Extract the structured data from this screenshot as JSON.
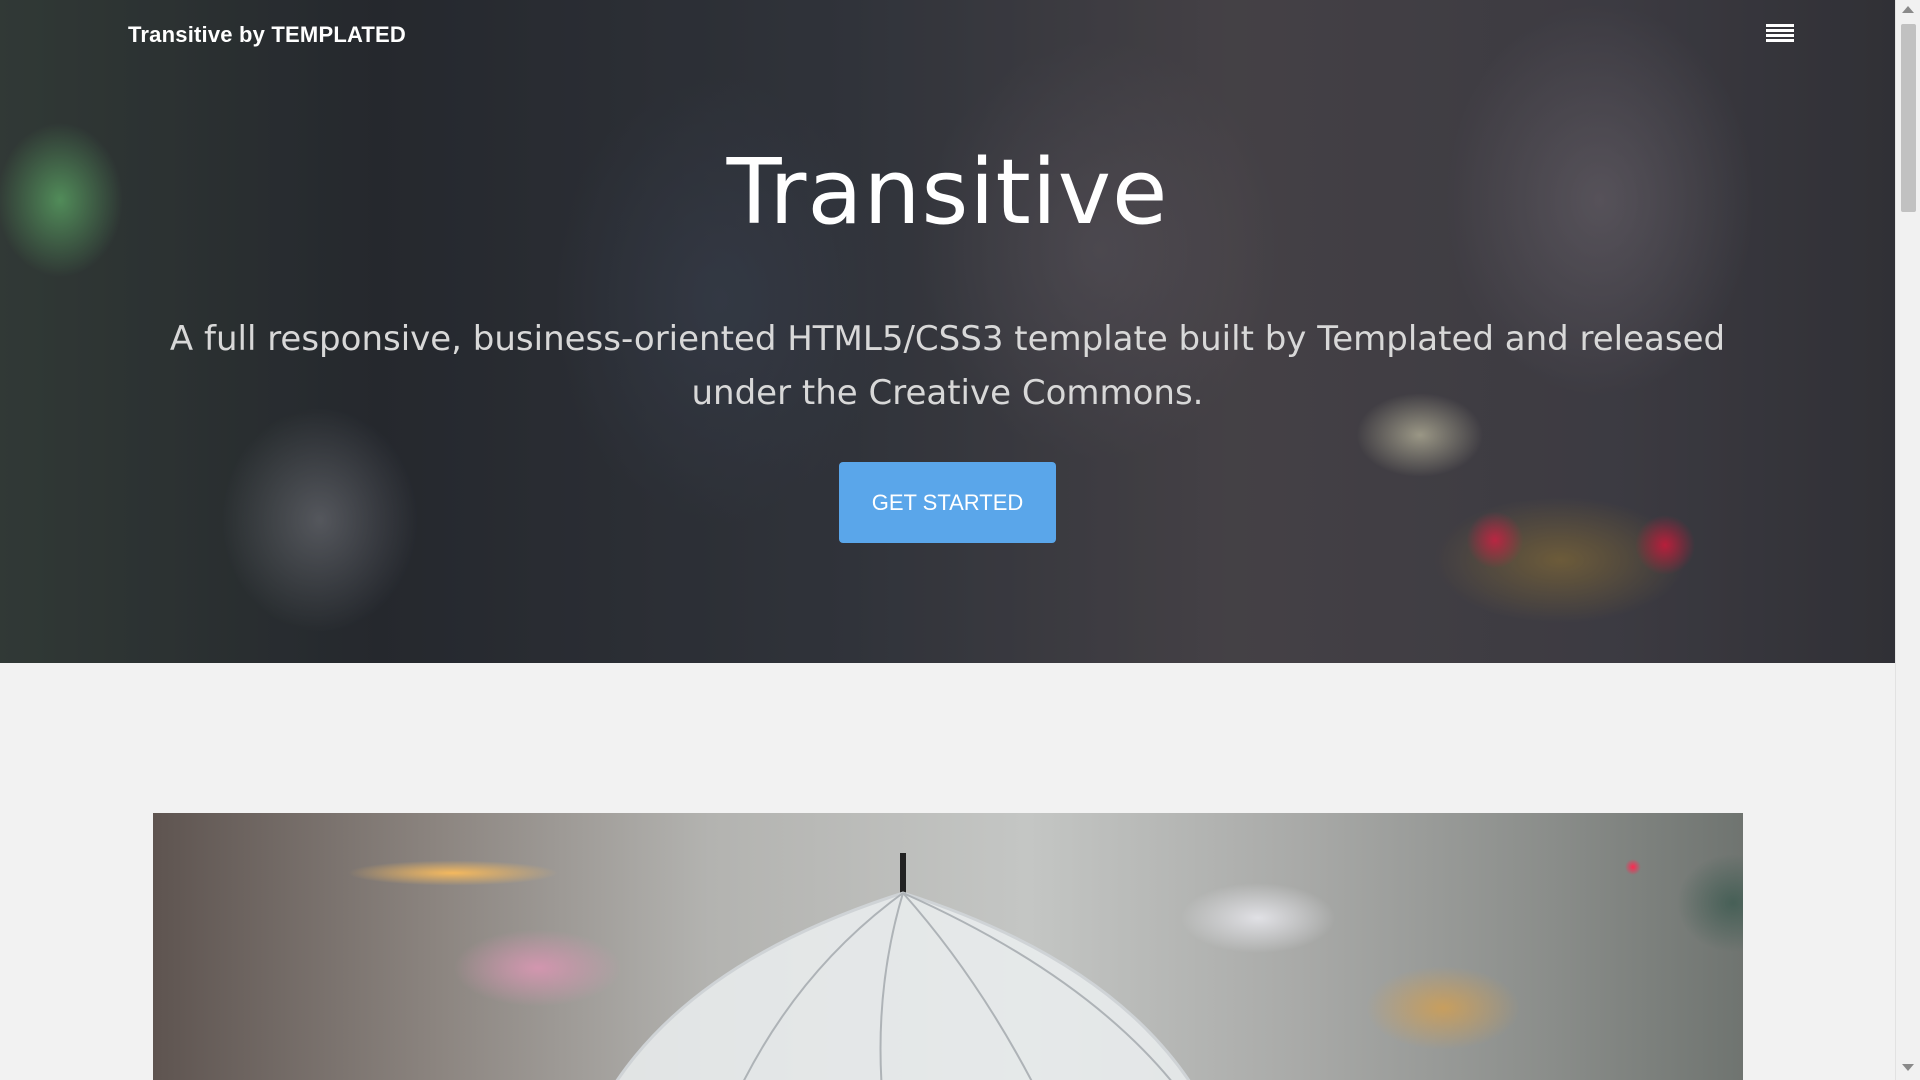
{
  "header": {
    "brand": "Transitive by TEMPLATED",
    "menu_icon": "hamburger-menu-icon"
  },
  "hero": {
    "title": "Transitive",
    "subtitle": "A full responsive, business-oriented HTML5/CSS3 template built by Templated and released under the Creative Commons.",
    "cta_label": "GET STARTED"
  },
  "colors": {
    "cta_background": "#5aa6ea",
    "page_background": "#f2f2f2",
    "text_light": "#ffffff"
  },
  "feature": {
    "image_icon": "umbrella-street-photo"
  }
}
